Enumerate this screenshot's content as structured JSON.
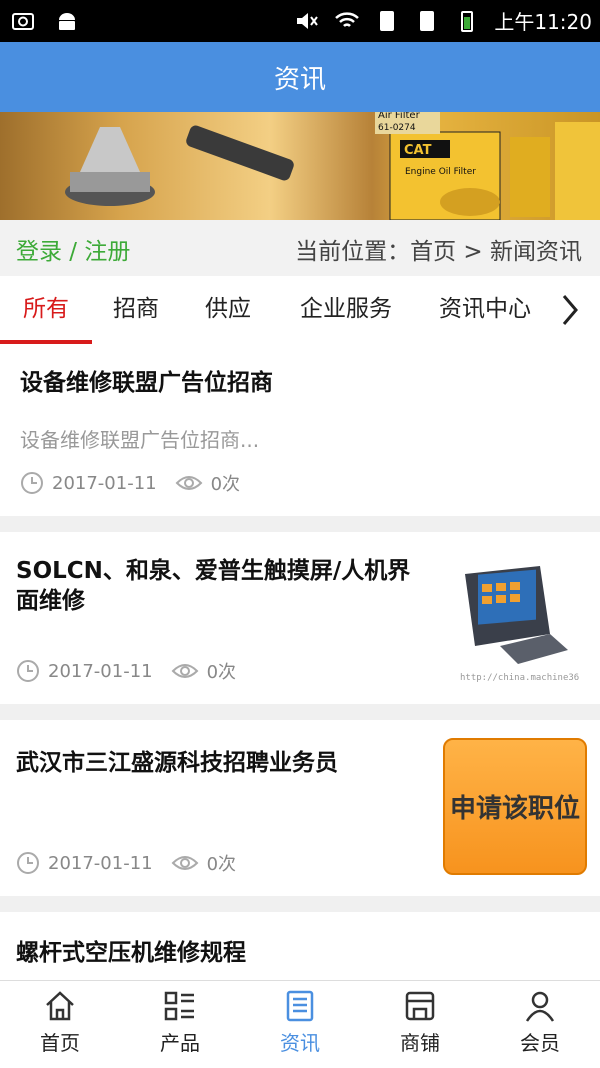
{
  "status": {
    "time": "上午11:20"
  },
  "appbar": {
    "title": "资讯"
  },
  "location": {
    "login_label": "登录 / 注册",
    "breadcrumb": "当前位置：首页 > 新闻资讯"
  },
  "tabs": [
    {
      "label": "所有",
      "active": true
    },
    {
      "label": "招商"
    },
    {
      "label": "供应"
    },
    {
      "label": "企业服务"
    },
    {
      "label": "资讯中心"
    }
  ],
  "articles": [
    {
      "title": "设备维修联盟广告位招商",
      "summary": "设备维修联盟广告位招商...",
      "date": "2017-01-11",
      "views": "0次"
    },
    {
      "title": "SOLCN、和泉、爱普生触摸屏/人机界面维修",
      "date": "2017-01-11",
      "views": "0次",
      "thumb_caption": "http://china.machine36"
    },
    {
      "title": "武汉市三江盛源科技招聘业务员",
      "date": "2017-01-11",
      "views": "0次",
      "thumb_text": "申请该职位"
    },
    {
      "title": "螺杆式空压机维修规程"
    }
  ],
  "banner": {
    "filter_label": "Air Filter",
    "filter_code": "61-0274",
    "cat_label": "CAT",
    "oil_filter_label": "Engine Oil Filter"
  },
  "bottom_nav": [
    {
      "label": "首页",
      "icon": "home-icon"
    },
    {
      "label": "产品",
      "icon": "list-grid-icon"
    },
    {
      "label": "资讯",
      "icon": "news-icon",
      "active": true
    },
    {
      "label": "商铺",
      "icon": "shop-icon"
    },
    {
      "label": "会员",
      "icon": "user-icon"
    }
  ],
  "colors": {
    "appbar": "#4a8fe0",
    "active_tab": "#d81b1b",
    "login": "#3daa38",
    "nav_active": "#4a8fe0"
  }
}
